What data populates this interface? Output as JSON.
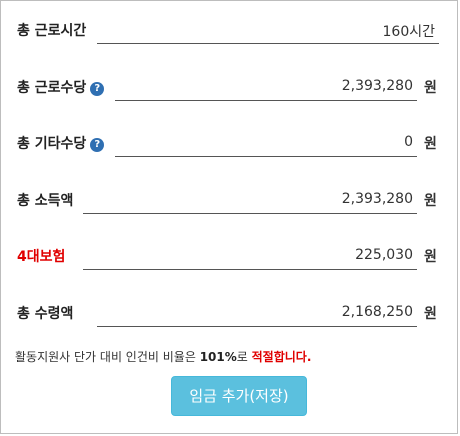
{
  "rows": [
    {
      "label": "총 근로시간",
      "value": "160시간",
      "unit": "",
      "help": false
    },
    {
      "label": "총 근로수당",
      "value": "2,393,280",
      "unit": "원",
      "help": true
    },
    {
      "label": "총 기타수당",
      "value": "0",
      "unit": "원",
      "help": true
    },
    {
      "label": "총 소득액",
      "value": "2,393,280",
      "unit": "원",
      "help": false
    },
    {
      "label": "4대보험",
      "value": "225,030",
      "unit": "원",
      "help": false
    },
    {
      "label": "총 수령액",
      "value": "2,168,250",
      "unit": "원",
      "help": false
    }
  ],
  "help_icon_glyph": "?",
  "ratio": {
    "prefix": "활동지원사 단가 대비 인건비 비율은 ",
    "percent": "101%",
    "middle": "로 ",
    "status": "적절합니다."
  },
  "save_button_label": "임금 추가(저장)",
  "colors": {
    "accent_red": "#e00000",
    "button": "#5bc0de",
    "help_icon": "#2f6fb2"
  }
}
